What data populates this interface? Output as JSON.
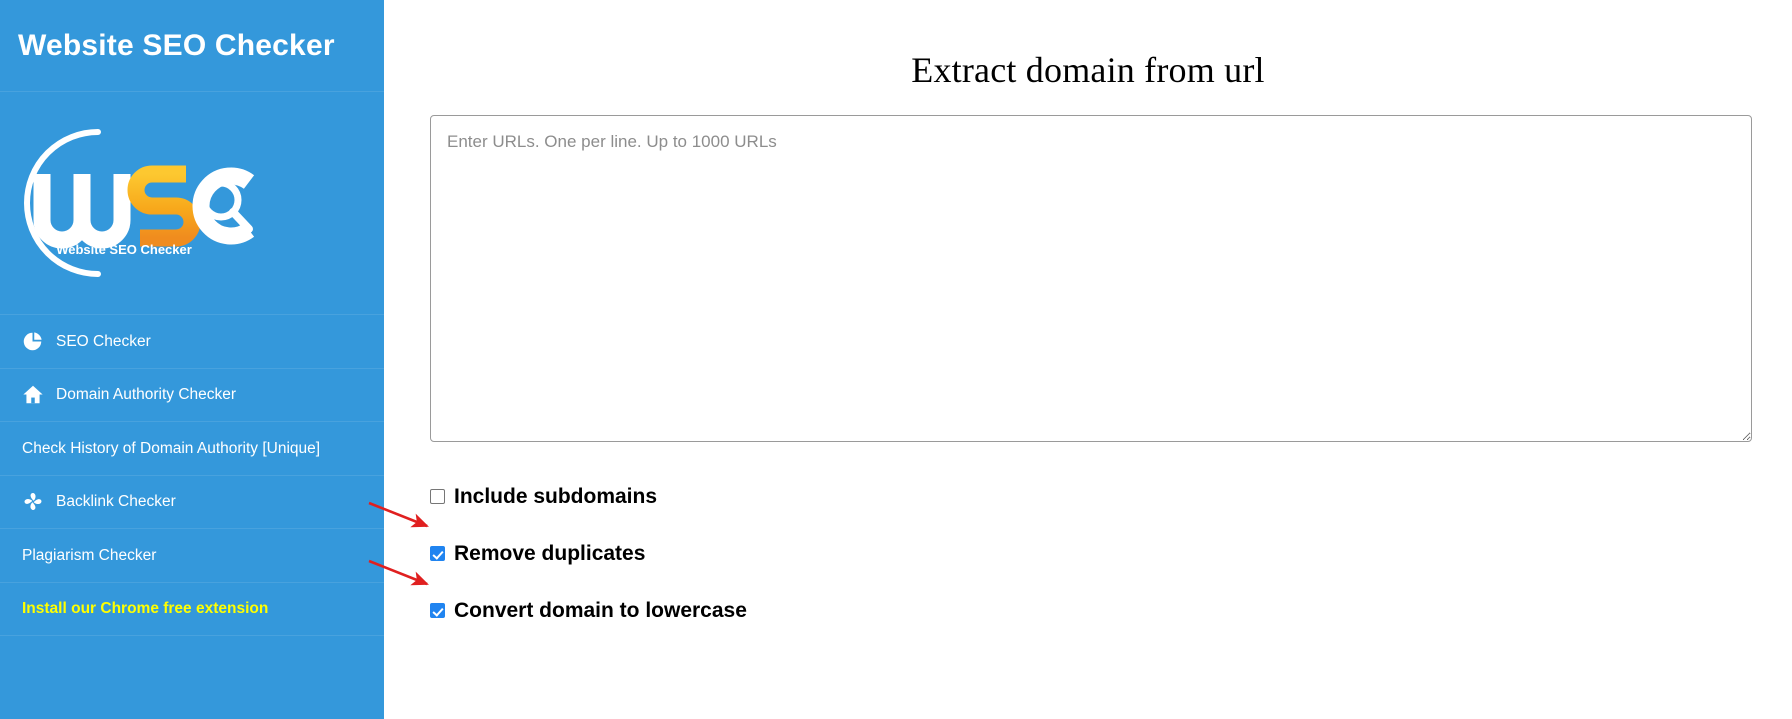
{
  "sidebar": {
    "title": "Website SEO Checker",
    "logo": {
      "letters": "WSC",
      "caption": "Website SEO Checker",
      "w_color": "#ffffff",
      "s_color": "#f6a623",
      "c_color": "#ffffff",
      "arc_color": "#ffffff",
      "background": "#3498db"
    },
    "items": [
      {
        "label": "SEO Checker",
        "icon": "pie-chart-icon",
        "highlight": false
      },
      {
        "label": "Domain Authority Checker",
        "icon": "home-icon",
        "highlight": false
      },
      {
        "label": "Check History of Domain Authority [Unique]",
        "icon": "none",
        "highlight": false
      },
      {
        "label": "Backlink Checker",
        "icon": "backlink-icon",
        "highlight": false
      },
      {
        "label": "Plagiarism Checker",
        "icon": "none",
        "highlight": false
      },
      {
        "label": "Install our Chrome free extension",
        "icon": "none",
        "highlight": true
      }
    ]
  },
  "main": {
    "title": "Extract domain from url",
    "textarea": {
      "placeholder": "Enter URLs. One per line. Up to 1000 URLs",
      "value": ""
    },
    "options": [
      {
        "label": "Include subdomains",
        "checked": false
      },
      {
        "label": "Remove duplicates",
        "checked": true
      },
      {
        "label": "Convert domain to lowercase",
        "checked": true
      }
    ]
  },
  "annotations": {
    "arrow_color": "#e02020",
    "arrows": [
      {
        "target": "Remove duplicates"
      },
      {
        "target": "Convert domain to lowercase"
      }
    ]
  },
  "colors": {
    "sidebar_background": "#3498db",
    "accent": "#2084f0",
    "highlight_text": "#ffff00",
    "page_background": "#ffffff"
  }
}
